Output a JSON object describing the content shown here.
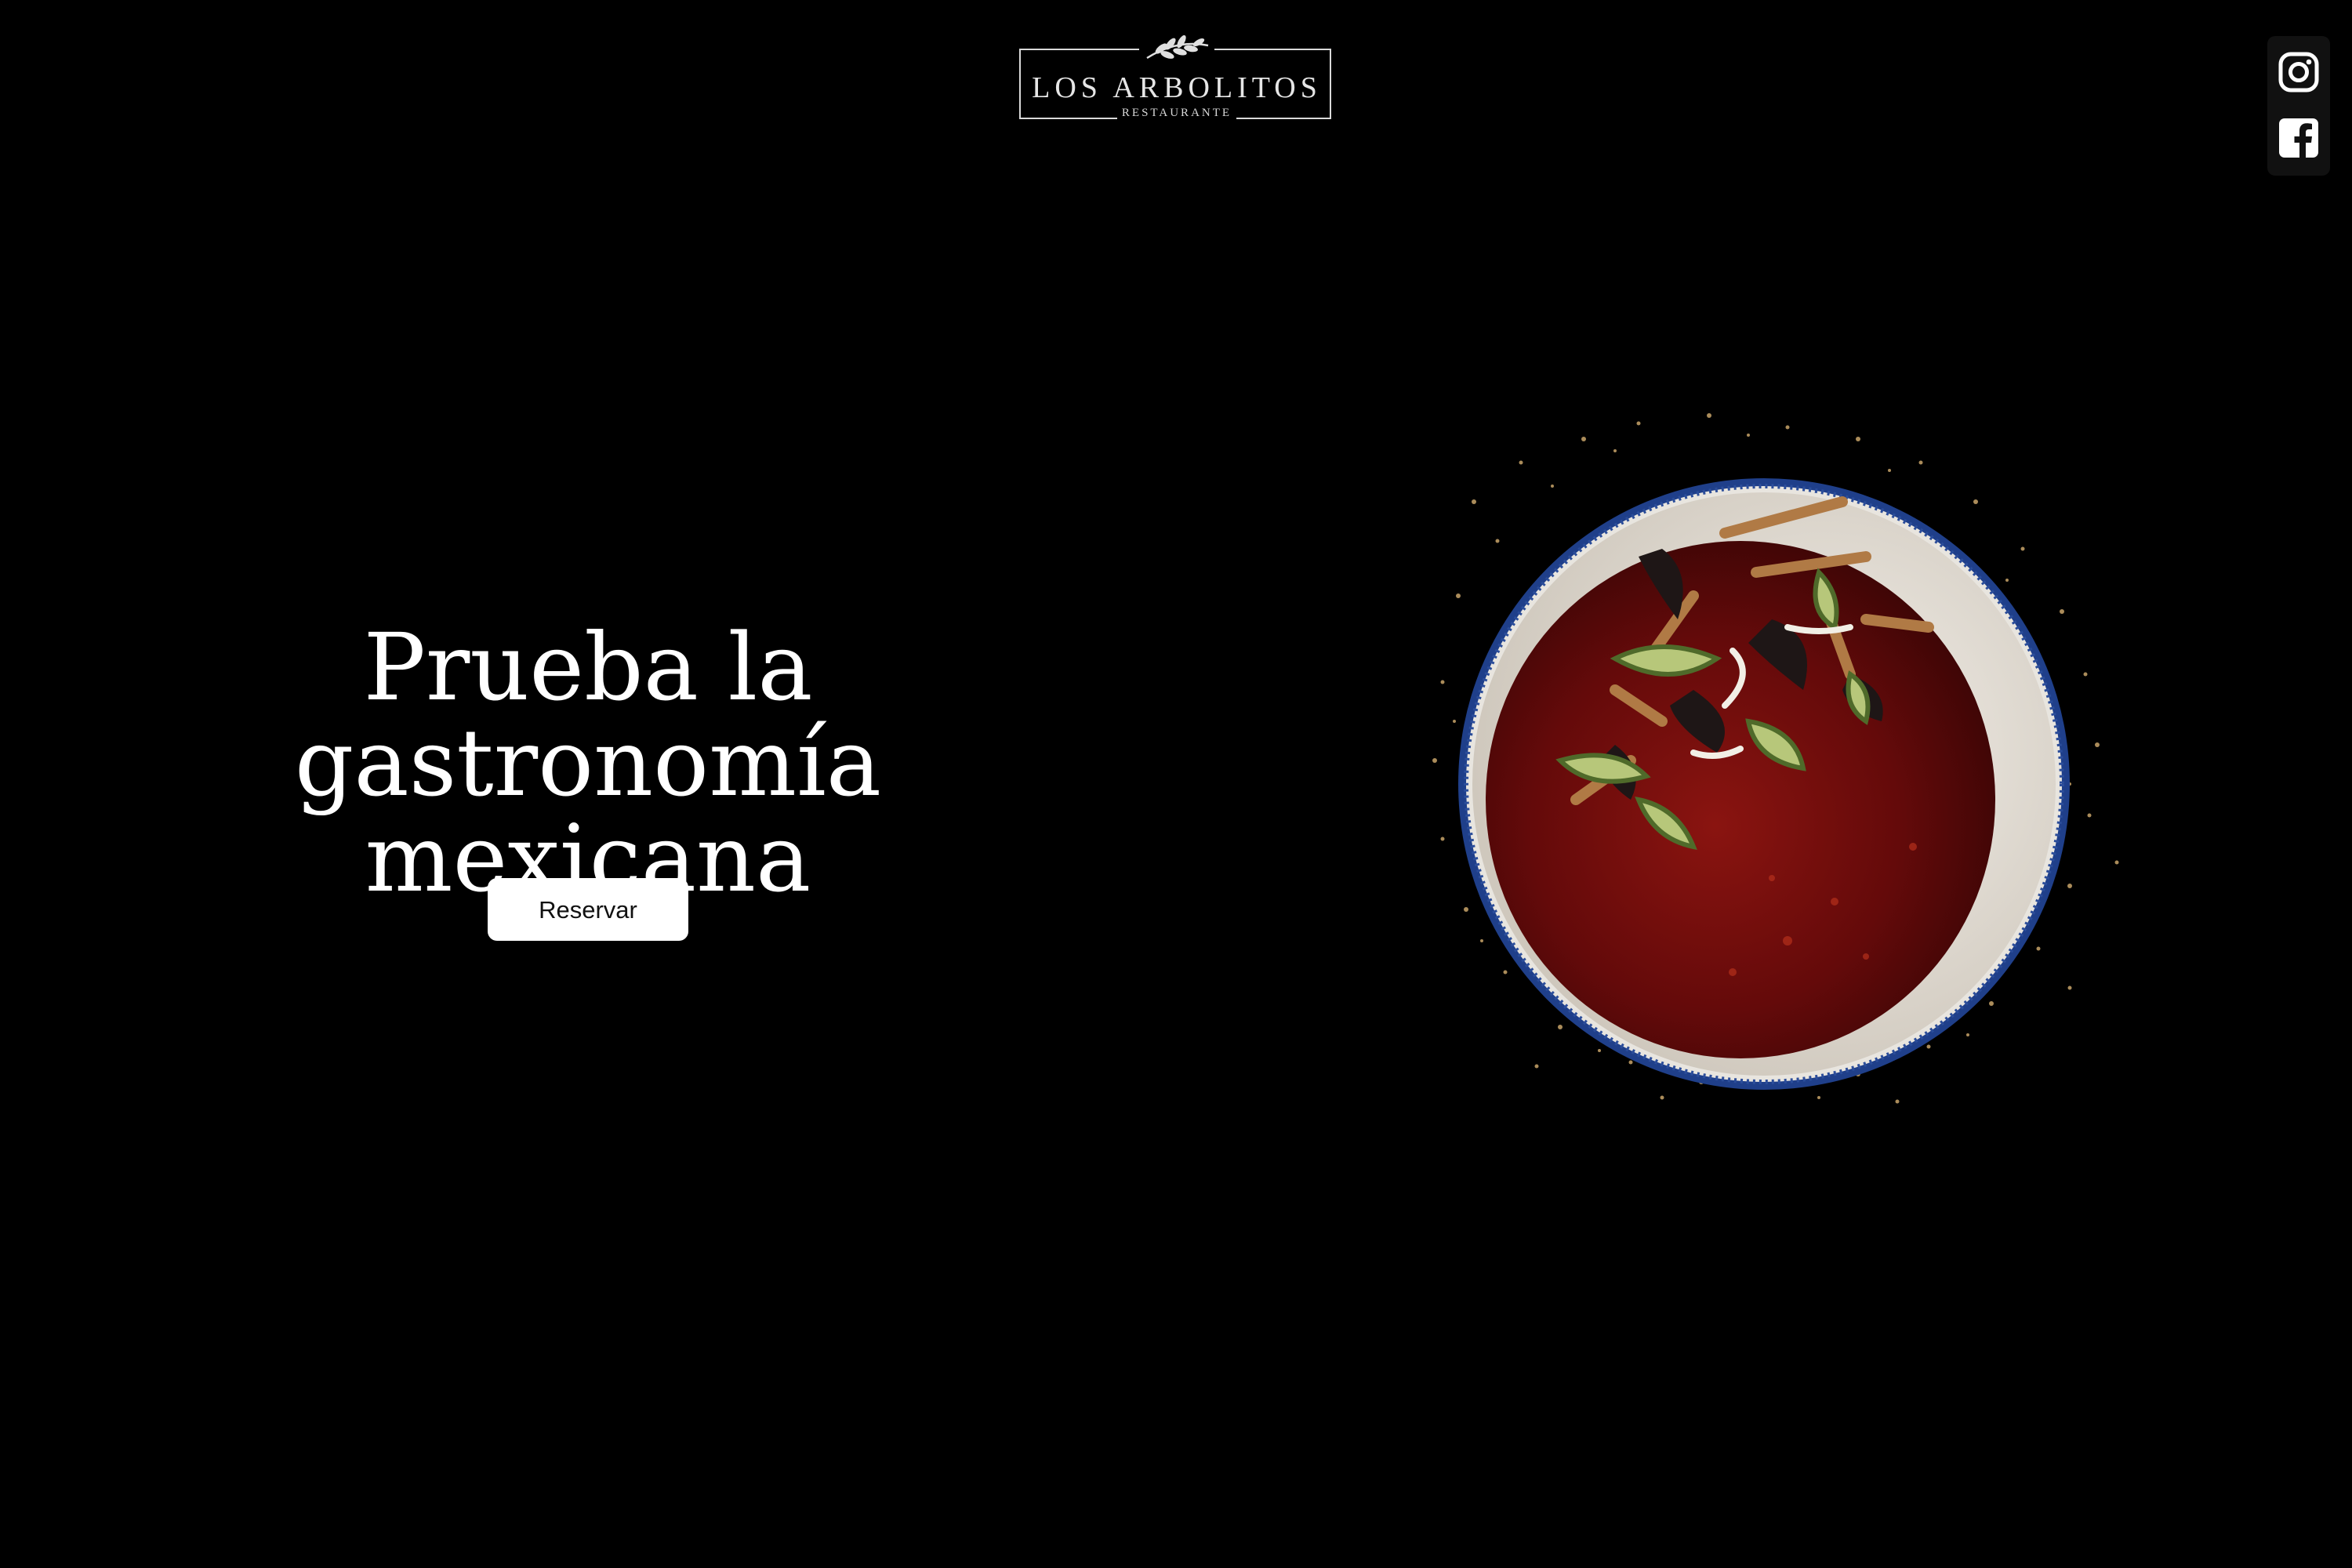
{
  "header": {
    "logo": {
      "name": "LOS ARBOLITOS",
      "subtitle": "RESTAURANTE"
    }
  },
  "social": {
    "items": [
      {
        "icon": "instagram-icon"
      },
      {
        "icon": "facebook-icon"
      }
    ]
  },
  "hero": {
    "title": "Prueba la gastronomía mexicana",
    "button_label": "Reservar"
  },
  "colors": {
    "background": "#000000",
    "text": "#ffffff",
    "button_bg": "#ffffff",
    "button_text": "#111111",
    "soup": "#6e0b0b",
    "bowl_rim": "#1f3f8a"
  }
}
